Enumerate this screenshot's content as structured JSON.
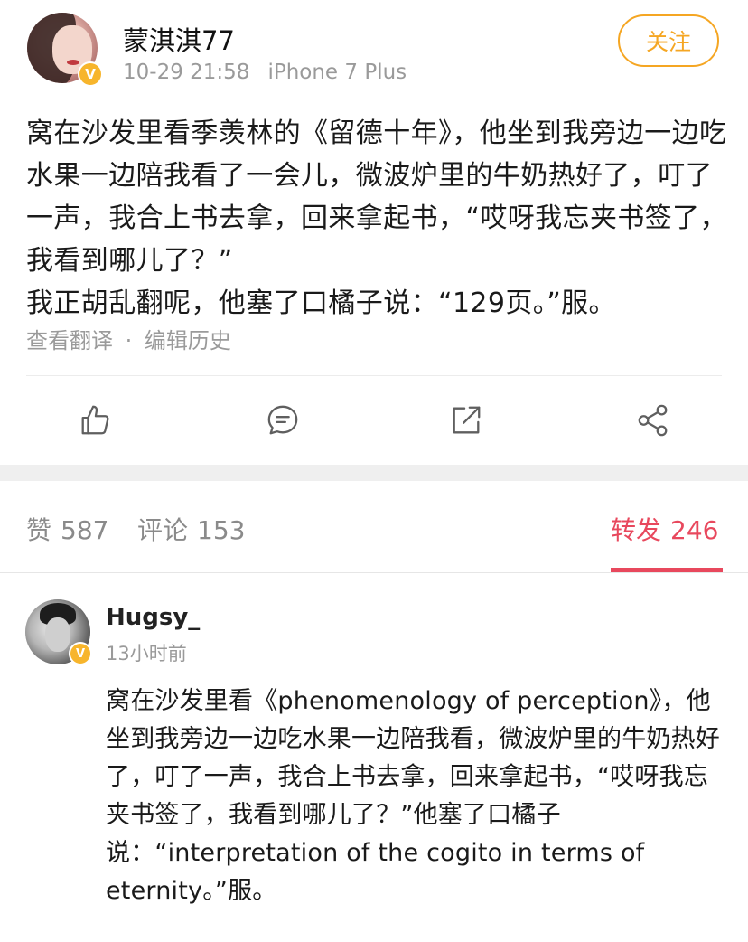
{
  "post": {
    "author": "蒙淇淇77",
    "timestamp": "10-29 21:58",
    "device": "iPhone 7 Plus",
    "follow_label": "关注",
    "verified_mark": "V",
    "avatar_icon": "user-avatar-icon",
    "text_paragraphs": [
      "窝在沙发里看季羡林的《留德十年》，他坐到我旁边一边吃水果一边陪我看了一会儿，微波炉里的牛奶热好了，叮了一声，我合上书去拿，回来拿起书，“哎呀我忘夹书签了，我看到哪儿了？”",
      "我正胡乱翻呢，他塞了口橘子说：“129页。”服。"
    ],
    "links": {
      "translate": "查看翻译",
      "separator": "·",
      "edit_history": "编辑历史"
    },
    "actions": [
      {
        "name": "like",
        "icon": "thumbs-up-icon"
      },
      {
        "name": "comment",
        "icon": "comment-icon"
      },
      {
        "name": "repost",
        "icon": "forward-icon"
      },
      {
        "name": "share",
        "icon": "share-icon"
      }
    ]
  },
  "tabs": [
    {
      "label": "赞",
      "count": "587",
      "active": false
    },
    {
      "label": "评论",
      "count": "153",
      "active": false
    },
    {
      "label": "转发",
      "count": "246",
      "active": true
    }
  ],
  "reposts": [
    {
      "author": "Hugsy_",
      "time": "13小时前",
      "verified_mark": "V",
      "text": "窝在沙发里看《phenomenology of perception》，他坐到我旁边一边吃水果一边陪我看，微波炉里的牛奶热好了，叮了一声，我合上书去拿，回来拿起书，“哎呀我忘夹书签了，我看到哪儿了？”他塞了口橘子说：“interpretation of the cogito in terms of eternity。”服。"
    }
  ],
  "colors": {
    "accent_orange": "#f5a623",
    "verified_badge": "#f7b52c",
    "active_tab": "#e8485d",
    "muted_text": "#9a9a9a",
    "band": "#efefef"
  }
}
